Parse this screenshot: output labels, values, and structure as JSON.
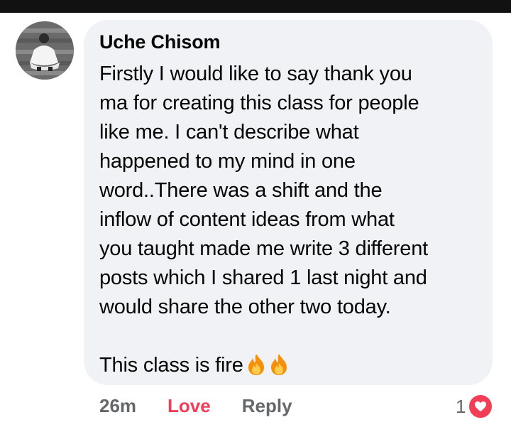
{
  "comment": {
    "author": "Uche Chisom",
    "text_lines": [
      "Firstly I would like to say thank you",
      "ma for creating this class for people",
      "like me. I can't describe what",
      "happened to my mind in one",
      "word..There was a shift and the",
      "inflow of content ideas from what",
      "you taught made me write 3 different",
      "posts which I shared 1 last night and",
      "would share the other two today."
    ],
    "closing_line": "This class is fire",
    "emojis": [
      "fire-icon",
      "fire-icon"
    ]
  },
  "actions": {
    "time": "26m",
    "love_label": "Love",
    "reply_label": "Reply"
  },
  "reaction": {
    "count": "1",
    "type": "heart-icon"
  },
  "colors": {
    "bubble": "#f0f2f5",
    "love": "#f33e58",
    "meta": "#65676b",
    "text": "#050505"
  }
}
